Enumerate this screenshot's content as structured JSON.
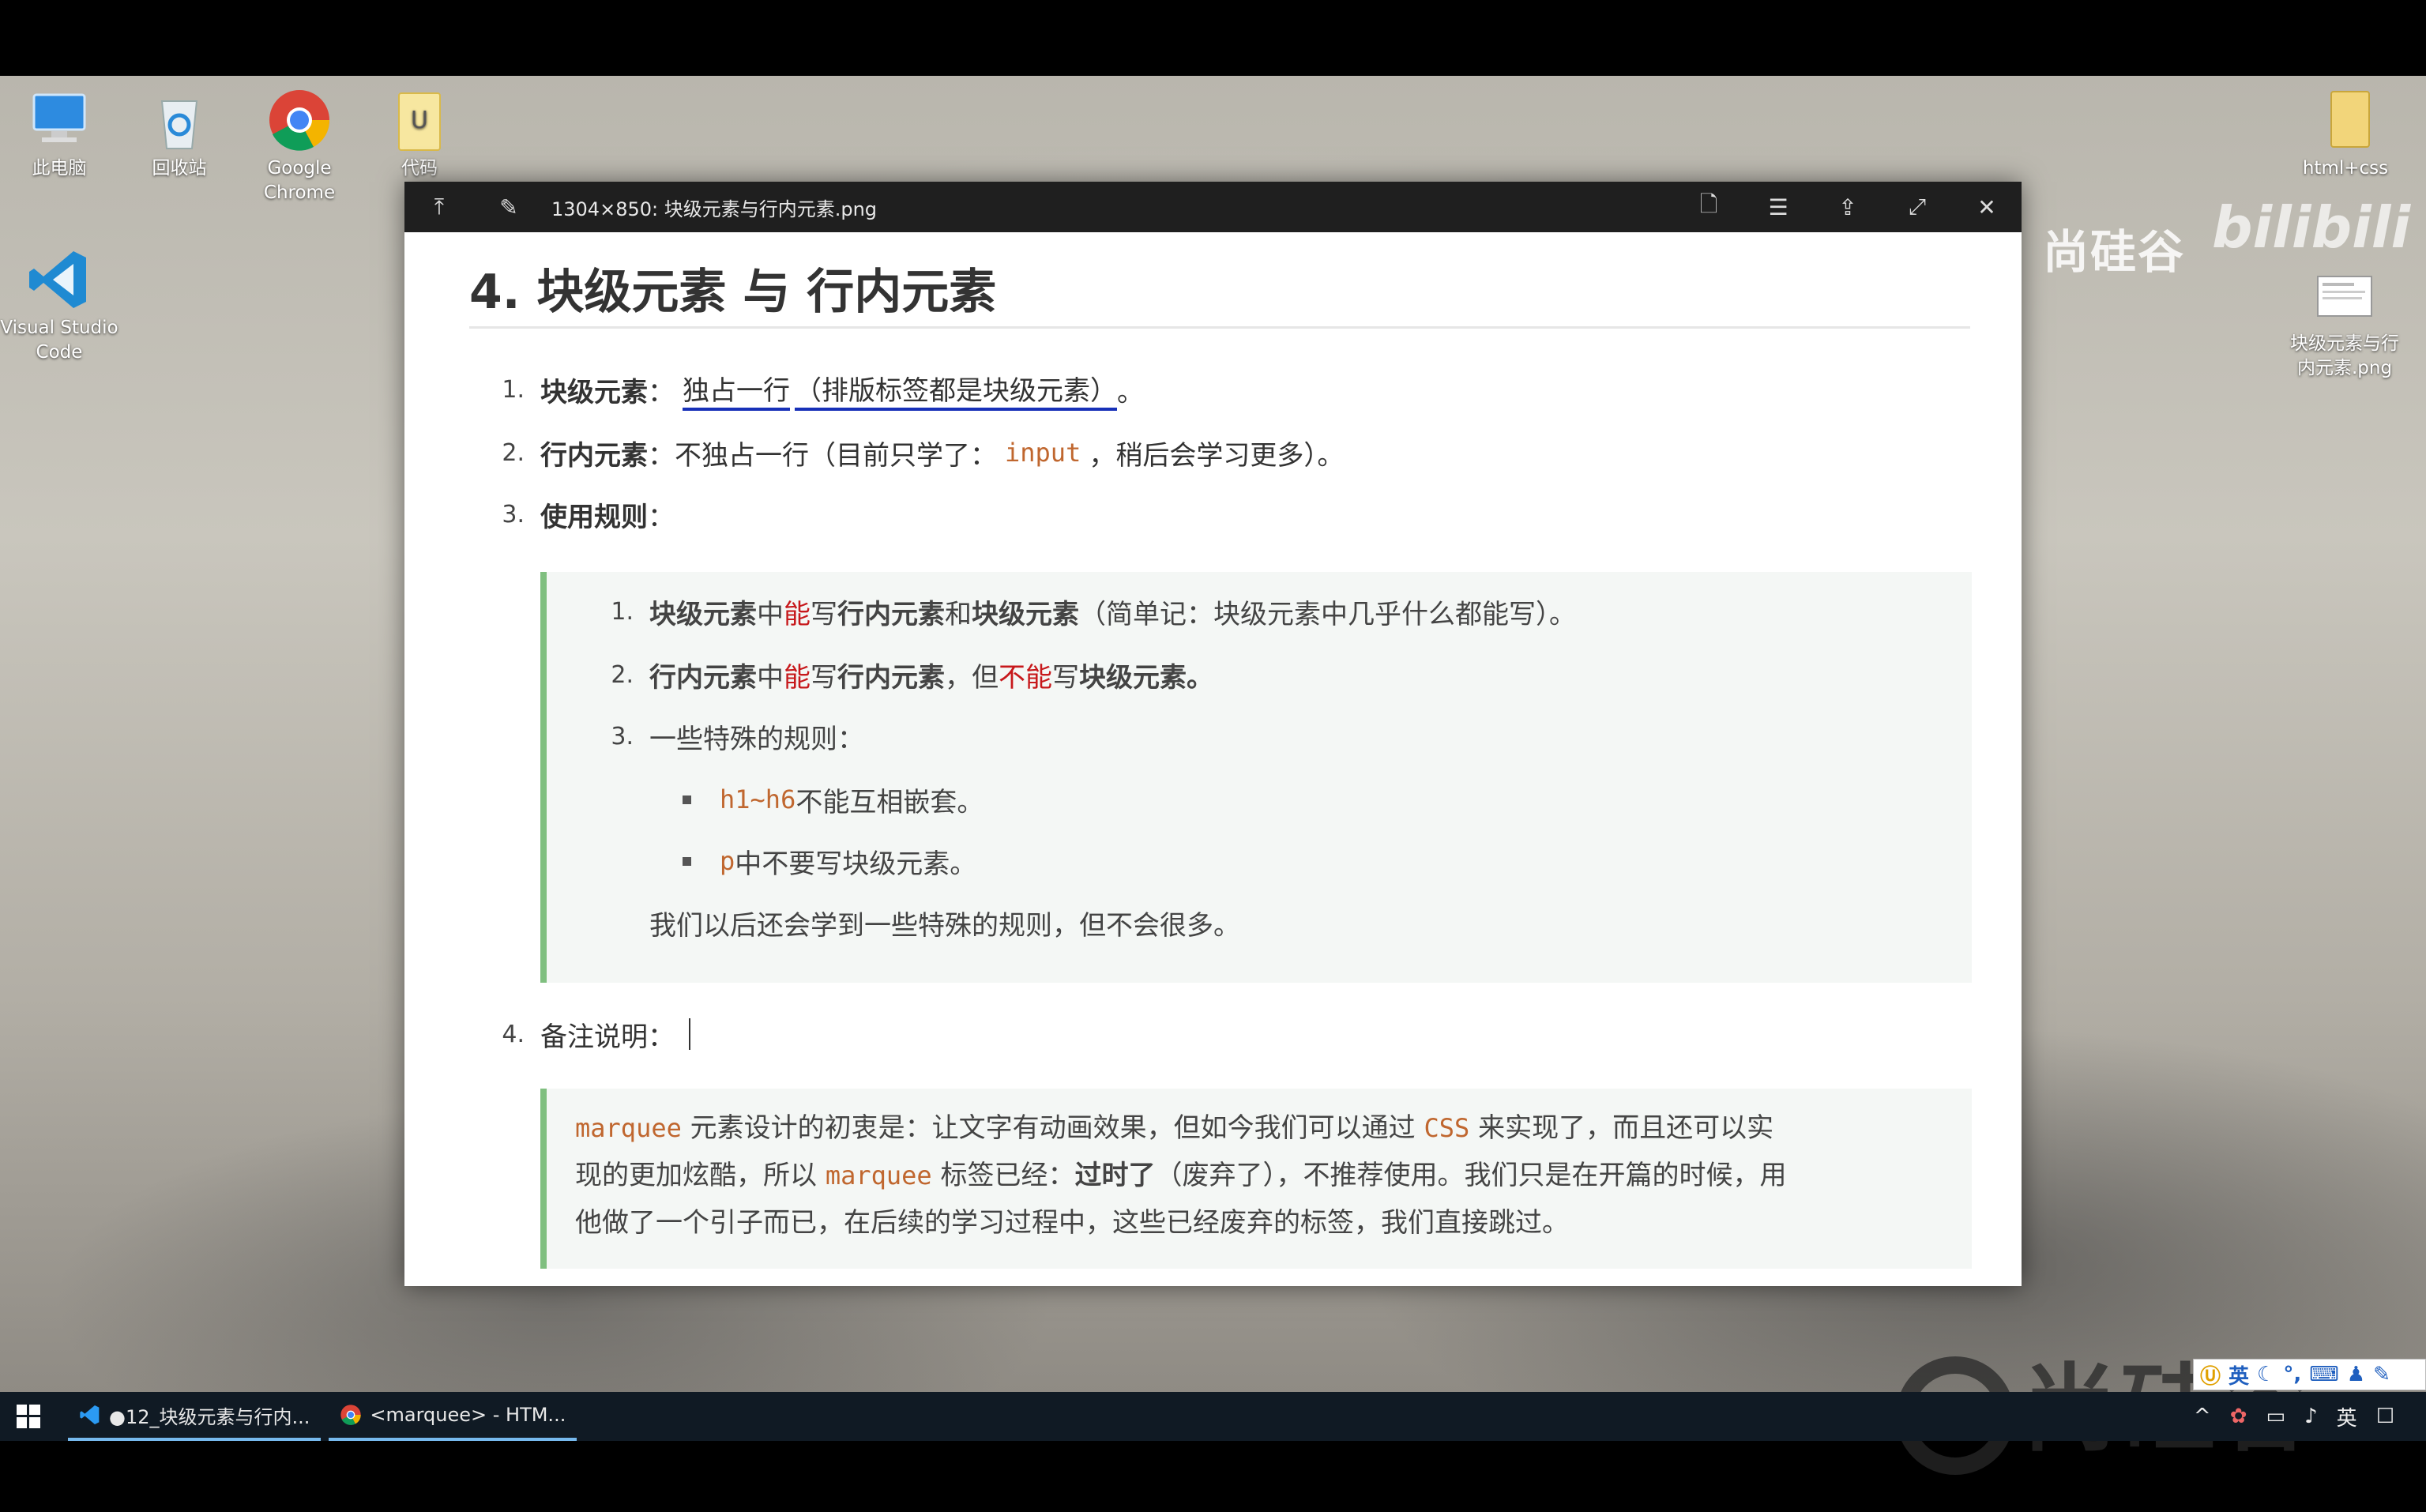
{
  "desktop": {
    "icons": [
      {
        "label": "此电脑"
      },
      {
        "label": "回收站"
      },
      {
        "label": "Google Chrome"
      },
      {
        "label": "代码"
      },
      {
        "label": "Visual Studio Code"
      },
      {
        "label": "html+css"
      },
      {
        "label": "块级元素与行内元素.png"
      }
    ],
    "watermark_top": "尚硅谷",
    "watermark_bili": "bilibili",
    "watermark_bottom": "尚硅谷"
  },
  "viewer": {
    "title": "1304×850: 块级元素与行内元素.png"
  },
  "doc": {
    "heading": "4. 块级元素 与 行内元素",
    "items": [
      {
        "num": "1.",
        "label": "块级元素",
        "sep": "：",
        "text1": "独占一行",
        "text2": "（排版标签都是块级元素）",
        "text3": "。"
      },
      {
        "num": "2.",
        "label": "行内元素",
        "sep": "：",
        "text1": "不独占一行（目前只学了：",
        "code": "input",
        "text2": "，稍后会学习更多）。"
      },
      {
        "num": "3.",
        "label": "使用规则",
        "sep": "："
      },
      {
        "num": "4.",
        "label": "备注说明："
      }
    ],
    "rules": [
      {
        "num": "1.",
        "a": "块级元素",
        "b": " 中",
        "c": "能",
        "d": "写 ",
        "e": "行内元素",
        "f": " 和 ",
        "g": "块级元素",
        "h": "（简单记：块级元素中几乎什么都能写）。"
      },
      {
        "num": "2.",
        "a": "行内元素",
        "b": " 中",
        "c": "能",
        "d": "写 ",
        "e": "行内元素",
        "f": "，但",
        "g": "不能",
        "h": "写 ",
        "i": "块级元素。"
      },
      {
        "num": "3.",
        "text": "一些特殊的规则："
      }
    ],
    "special": [
      {
        "code": "h1~h6",
        "text": " 不能互相嵌套。"
      },
      {
        "code": "p",
        "text": " 中不要写块级元素。"
      }
    ],
    "special_note": "我们以后还会学到一些特殊的规则，但不会很多。",
    "note": {
      "code1": "marquee",
      "t1": " 元素设计的初衷是：让文字有动画效果，但如今我们可以通过 ",
      "code2": "CSS",
      "t2": " 来实现了，而且还可以实",
      "t3": "现的更加炫酷，所以 ",
      "code3": "marquee",
      "t4": " 标签已经：",
      "bold": "过时了",
      "t5": "（废弃了），不推荐使用。我们只是在开篇的时候，用",
      "t6": "他做了一个引子而已，在后续的学习过程中，这些已经废弃的标签，我们直接跳过。"
    }
  },
  "taskbar": {
    "apps": [
      {
        "label": "●12_块级元素与行内..."
      },
      {
        "label": "<marquee> - HTM..."
      }
    ],
    "tray_lang": "英"
  },
  "ime": {
    "lang": "英"
  }
}
